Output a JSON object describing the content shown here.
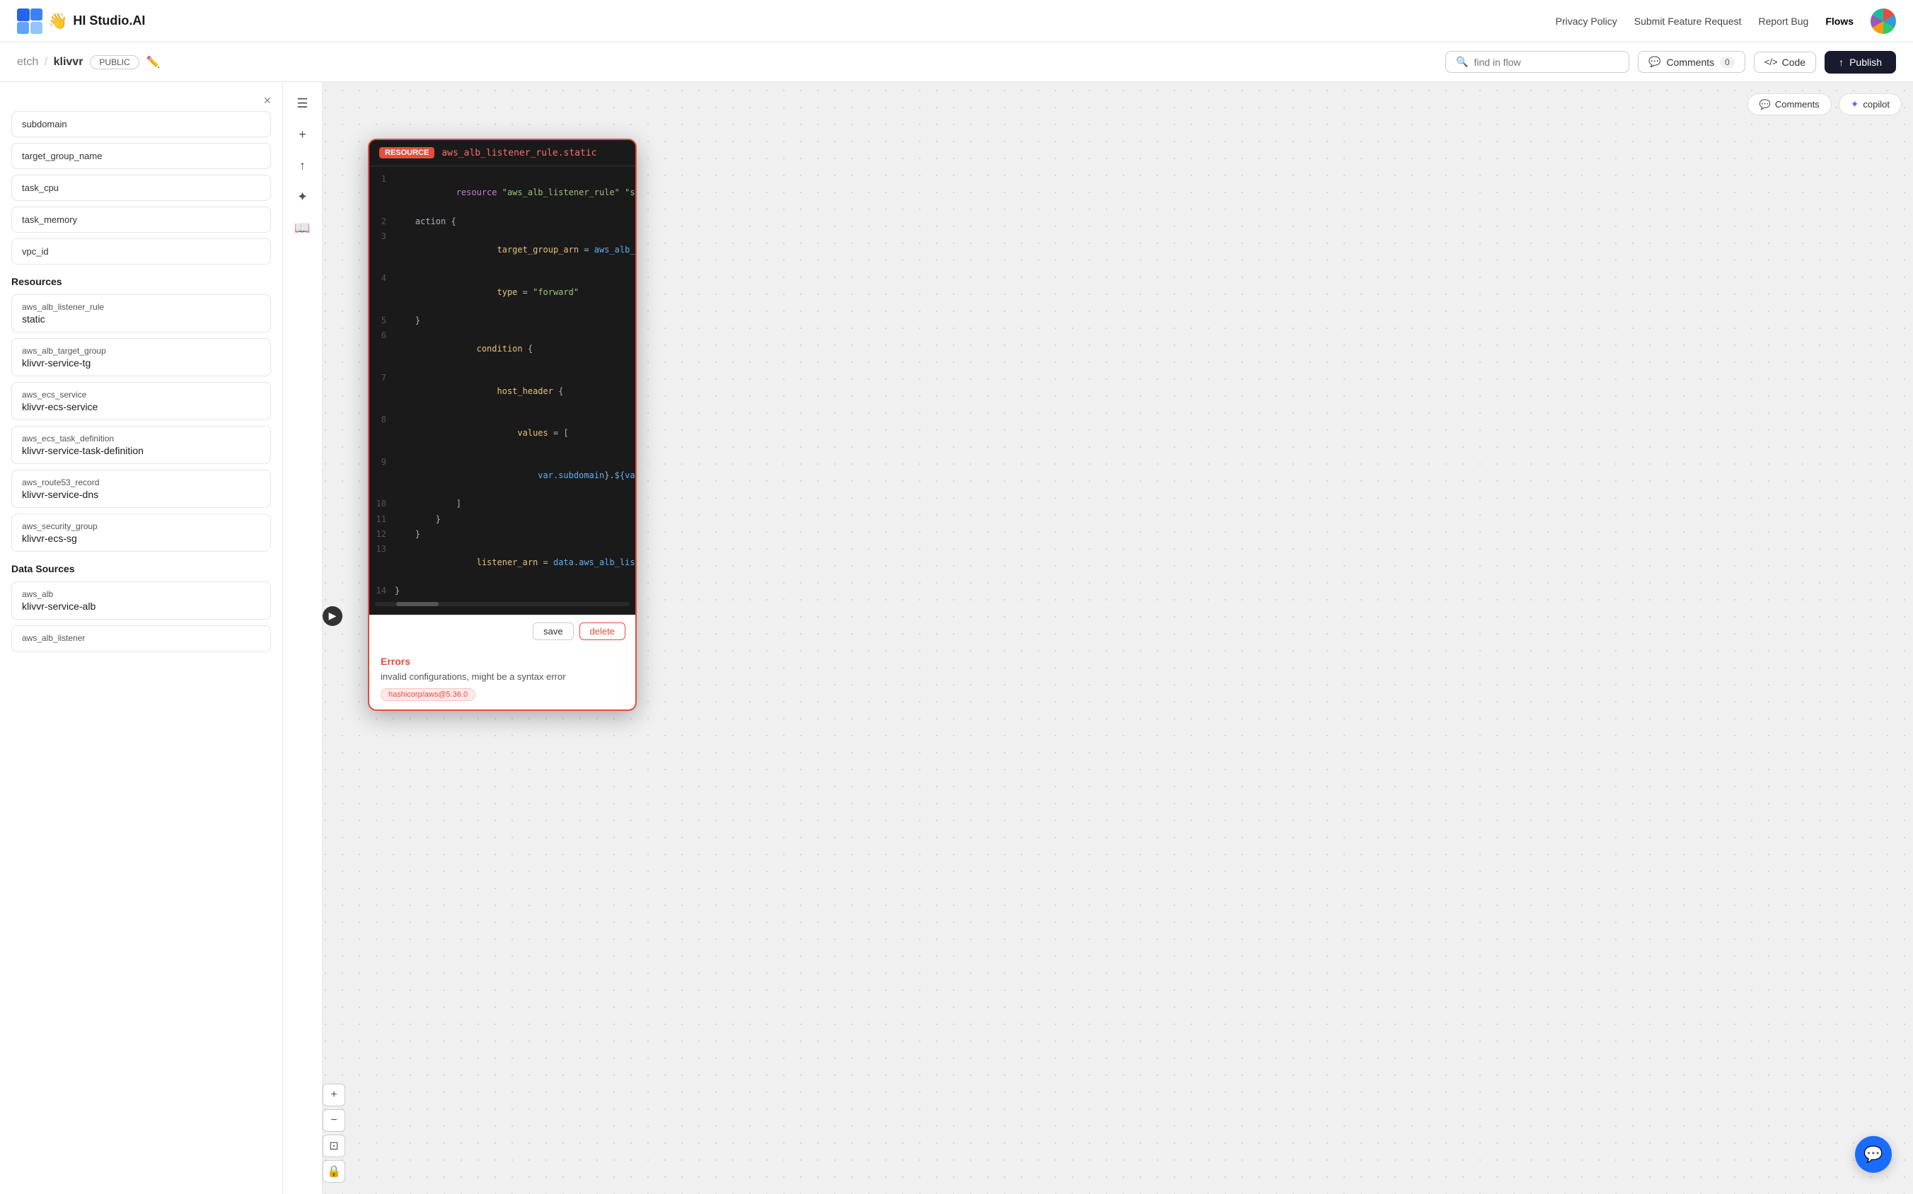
{
  "app": {
    "logo_emoji": "👋",
    "title": "HI Studio.AI"
  },
  "nav": {
    "privacy_policy": "Privacy Policy",
    "submit_feature": "Submit Feature Request",
    "report_bug": "Report Bug",
    "flows": "Flows"
  },
  "subnav": {
    "breadcrumb_parent": "etch",
    "breadcrumb_separator": "/",
    "breadcrumb_child": "klivvr",
    "public_badge": "PUBLIC",
    "search_placeholder": "find in flow",
    "comments_label": "Comments",
    "comments_count": "0",
    "code_label": "Code",
    "publish_label": "Publish"
  },
  "sidebar": {
    "close_label": "×",
    "partial_item": "subdomain",
    "basic_items": [
      "target_group_name",
      "task_cpu",
      "task_memory",
      "vpc_id"
    ],
    "resources_title": "Resources",
    "resources": [
      {
        "type": "aws_alb_listener_rule",
        "name": "static"
      },
      {
        "type": "aws_alb_target_group",
        "name": "klivvr-service-tg"
      },
      {
        "type": "aws_ecs_service",
        "name": "klivvr-ecs-service"
      },
      {
        "type": "aws_ecs_task_definition",
        "name": "klivvr-service-task-definition"
      },
      {
        "type": "aws_route53_record",
        "name": "klivvr-service-dns"
      },
      {
        "type": "aws_security_group",
        "name": "klivvr-ecs-sg"
      }
    ],
    "data_sources_title": "Data Sources",
    "data_sources": [
      {
        "type": "aws_alb",
        "name": "klivvr-service-alb"
      },
      {
        "type": "aws_alb_listener",
        "name": ""
      }
    ]
  },
  "canvas": {
    "comments_btn": "Comments",
    "copilot_btn": "copilot"
  },
  "resource_card": {
    "label": "RESOURCE",
    "name": "aws_alb_listener_rule.static",
    "code_lines": [
      {
        "num": "1",
        "content": "resource \"aws_alb_listener_rule\" \"static\""
      },
      {
        "num": "2",
        "content": "    action {"
      },
      {
        "num": "3",
        "content": "        target_group_arn = aws_alb_target_"
      },
      {
        "num": "4",
        "content": "        type = \"forward\""
      },
      {
        "num": "5",
        "content": "    }"
      },
      {
        "num": "6",
        "content": "    condition {"
      },
      {
        "num": "7",
        "content": "        host_header {"
      },
      {
        "num": "8",
        "content": "            values = ["
      },
      {
        "num": "9",
        "content": "                var.subdomain}.${var.domai"
      },
      {
        "num": "10",
        "content": "            ]"
      },
      {
        "num": "11",
        "content": "        }"
      },
      {
        "num": "12",
        "content": "    }"
      },
      {
        "num": "13",
        "content": "    listener_arn = data.aws_alb_listener.k"
      },
      {
        "num": "14",
        "content": "}"
      }
    ],
    "save_label": "save",
    "delete_label": "delete",
    "errors_title": "Errors",
    "errors_message": "invalid configurations, might be a syntax error",
    "error_badge": "hashicorp/aws@5.36.0"
  },
  "chat_btn": "💬"
}
